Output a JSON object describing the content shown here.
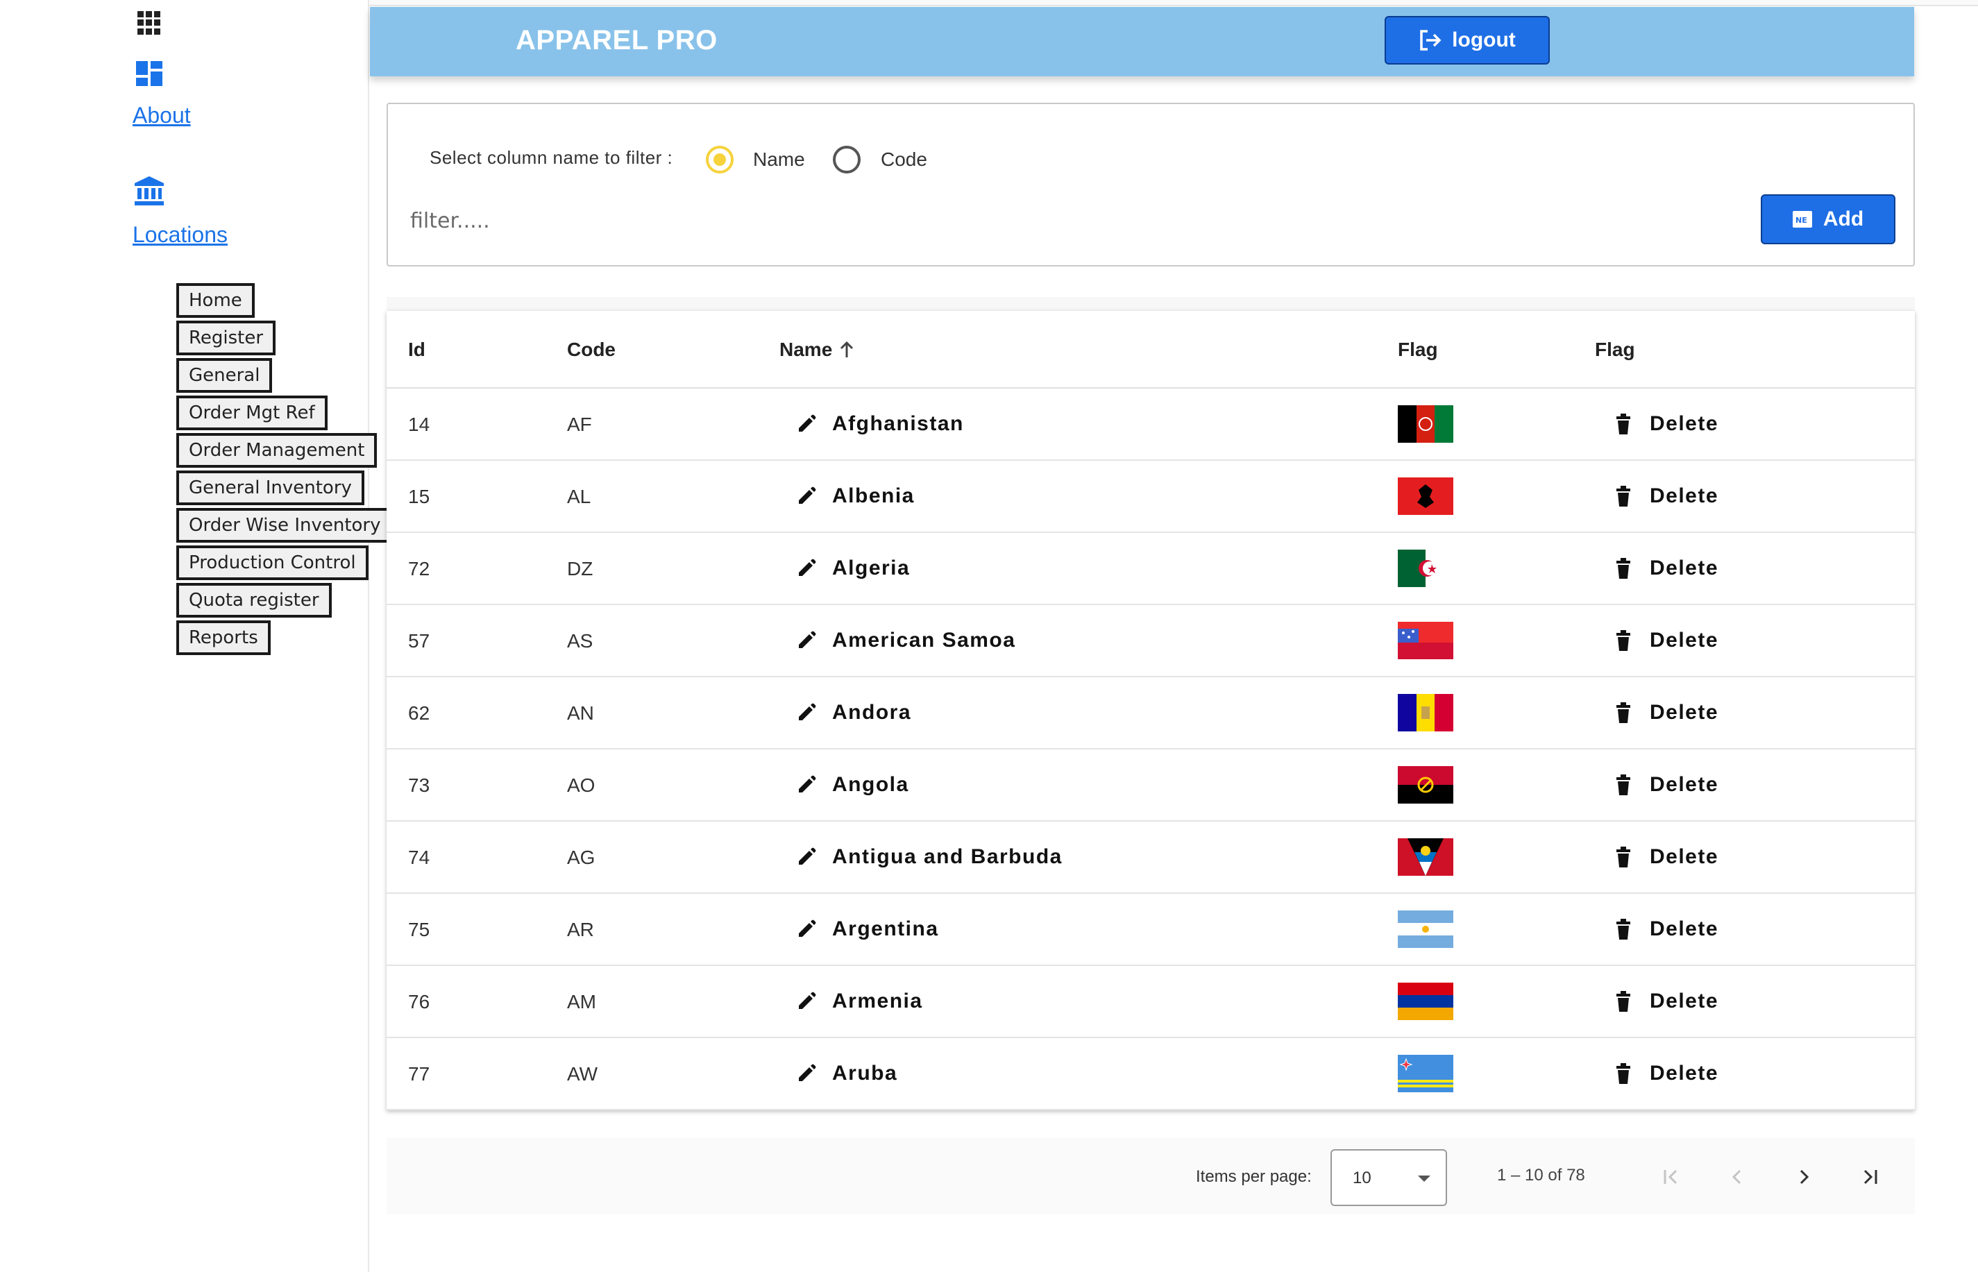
{
  "sidebar": {
    "about_label": "About",
    "locations_label": "Locations",
    "nav_buttons": [
      "Home",
      "Register",
      "General",
      "Order Mgt Ref",
      "Order Management",
      "General Inventory",
      "Order Wise Inventory",
      "Production Control",
      "Quota register",
      "Reports"
    ]
  },
  "header": {
    "title": "APPAREL PRO",
    "logout_label": "logout"
  },
  "filter": {
    "label": "Select column name to filter :",
    "options": [
      "Name",
      "Code"
    ],
    "selected": "Name",
    "placeholder": "filter.....",
    "add_label": "Add"
  },
  "table": {
    "columns": [
      "Id",
      "Code",
      "Name",
      "Flag",
      "Flag"
    ],
    "sort_column": "Name",
    "sort_direction": "asc",
    "delete_label": "Delete",
    "rows": [
      {
        "id": "14",
        "code": "AF",
        "name": "Afghanistan"
      },
      {
        "id": "15",
        "code": "AL",
        "name": "Albenia"
      },
      {
        "id": "72",
        "code": "DZ",
        "name": "Algeria"
      },
      {
        "id": "57",
        "code": "AS",
        "name": "American Samoa"
      },
      {
        "id": "62",
        "code": "AN",
        "name": "Andora"
      },
      {
        "id": "73",
        "code": "AO",
        "name": "Angola"
      },
      {
        "id": "74",
        "code": "AG",
        "name": "Antigua and Barbuda"
      },
      {
        "id": "75",
        "code": "AR",
        "name": "Argentina"
      },
      {
        "id": "76",
        "code": "AM",
        "name": "Armenia"
      },
      {
        "id": "77",
        "code": "AW",
        "name": "Aruba"
      }
    ]
  },
  "paginator": {
    "items_per_page_label": "Items per page:",
    "page_size": "10",
    "range_label": "1 – 10 of 78"
  },
  "colors": {
    "header_bg": "#88c2ea",
    "primary_button": "#1e6fe6",
    "link": "#1a73e8",
    "radio_selected": "#f6d23c"
  }
}
